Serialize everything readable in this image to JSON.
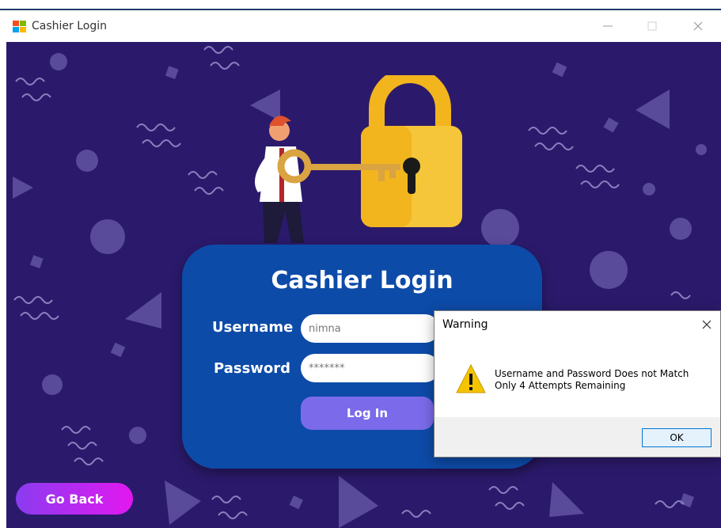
{
  "window": {
    "title": "Cashier Login",
    "controls": [
      "minimize-icon",
      "maximize-icon",
      "close-icon"
    ]
  },
  "login_card": {
    "title": "Cashier Login",
    "username_label": "Username",
    "username_value": "nimna",
    "password_label": "Password",
    "password_value": "*******",
    "login_button": "Log In"
  },
  "go_back_button": "Go Back",
  "dialog": {
    "title": "Warning",
    "message_line1": "Username and Password Does not Match",
    "message_line2": "Only 4 Attempts Remaining",
    "ok_button": "OK",
    "icon": "warning-icon"
  },
  "colors": {
    "background": "#2b1a6b",
    "card": "#0d4ba8",
    "login_button": "#7b6bea",
    "go_back_gradient_start": "#8a3cf0",
    "go_back_gradient_end": "#e218f0",
    "lock": "#f2b51e"
  }
}
